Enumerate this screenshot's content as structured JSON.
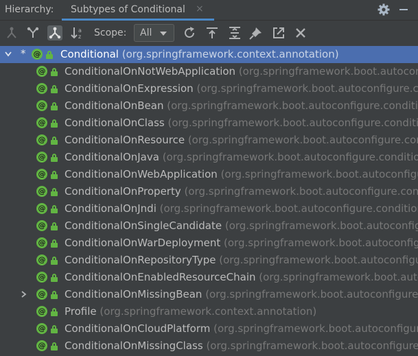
{
  "header": {
    "label": "Hierarchy:",
    "tab_title": "Subtypes of Conditional",
    "tab_close": "×"
  },
  "toolbar": {
    "scope_label": "Scope:",
    "scope_value": "All"
  },
  "tree": {
    "root": {
      "marker": "*",
      "name": "Conditional",
      "package": "(org.springframework.context.annotation)"
    },
    "items": [
      {
        "name": "ConditionalOnNotWebApplication",
        "package": "(org.springframework.boot.autoconfigure.condition)"
      },
      {
        "name": "ConditionalOnExpression",
        "package": "(org.springframework.boot.autoconfigure.condition)"
      },
      {
        "name": "ConditionalOnBean",
        "package": "(org.springframework.boot.autoconfigure.condition)"
      },
      {
        "name": "ConditionalOnClass",
        "package": "(org.springframework.boot.autoconfigure.condition)"
      },
      {
        "name": "ConditionalOnResource",
        "package": "(org.springframework.boot.autoconfigure.condition)"
      },
      {
        "name": "ConditionalOnJava",
        "package": "(org.springframework.boot.autoconfigure.condition)"
      },
      {
        "name": "ConditionalOnWebApplication",
        "package": "(org.springframework.boot.autoconfigure.condition)"
      },
      {
        "name": "ConditionalOnProperty",
        "package": "(org.springframework.boot.autoconfigure.condition)"
      },
      {
        "name": "ConditionalOnJndi",
        "package": "(org.springframework.boot.autoconfigure.condition)"
      },
      {
        "name": "ConditionalOnSingleCandidate",
        "package": "(org.springframework.boot.autoconfigure.condition)"
      },
      {
        "name": "ConditionalOnWarDeployment",
        "package": "(org.springframework.boot.autoconfigure.condition)"
      },
      {
        "name": "ConditionalOnRepositoryType",
        "package": "(org.springframework.boot.autoconfigure.data)"
      },
      {
        "name": "ConditionalOnEnabledResourceChain",
        "package": "(org.springframework.boot.autoconfigure.web)"
      },
      {
        "name": "ConditionalOnMissingBean",
        "package": "(org.springframework.boot.autoconfigure.condition)"
      },
      {
        "name": "Profile",
        "package": "(org.springframework.context.annotation)"
      },
      {
        "name": "ConditionalOnCloudPlatform",
        "package": "(org.springframework.boot.autoconfigure.condition)"
      },
      {
        "name": "ConditionalOnMissingClass",
        "package": "(org.springframework.boot.autoconfigure.condition)"
      }
    ]
  },
  "colors": {
    "background": "#3c3f41",
    "selection": "#4b6eaf",
    "accent_underline": "#4a88c7",
    "annotation_icon": "#62b543",
    "package_text": "#787878"
  }
}
